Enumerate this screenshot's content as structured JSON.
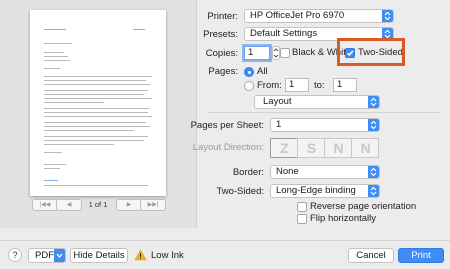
{
  "preview": {
    "pager_label": "1 of 1",
    "first_icon": "first-page-icon",
    "prev_icon": "previous-page-icon",
    "next_icon": "next-page-icon",
    "last_icon": "last-page-icon"
  },
  "printer": {
    "label": "Printer:",
    "value": "HP OfficeJet Pro 6970"
  },
  "presets": {
    "label": "Presets:",
    "value": "Default Settings"
  },
  "copies": {
    "label": "Copies:",
    "value": "1"
  },
  "black_white": {
    "label": "Black & White",
    "checked": false
  },
  "two_sided_check": {
    "label": "Two-Sided",
    "checked": true
  },
  "pages": {
    "label": "Pages:",
    "all_label": "All",
    "from_label": "From:",
    "from_value": "1",
    "to_label": "to:",
    "to_value": "1",
    "selected": "all"
  },
  "section": {
    "value": "Layout"
  },
  "pages_per_sheet": {
    "label": "Pages per Sheet:",
    "value": "1"
  },
  "layout_direction": {
    "label": "Layout Direction:",
    "glyphs": [
      "Z",
      "S",
      "N",
      "N"
    ]
  },
  "border": {
    "label": "Border:",
    "value": "None"
  },
  "two_sided": {
    "label": "Two-Sided:",
    "value": "Long-Edge binding"
  },
  "reverse_orientation": {
    "label": "Reverse page orientation",
    "checked": false
  },
  "flip_horizontally": {
    "label": "Flip horizontally",
    "checked": false
  },
  "bottom": {
    "help_label": "?",
    "pdf_label": "PDF",
    "hide_details_label": "Hide Details",
    "low_ink_label": "Low Ink",
    "cancel_label": "Cancel",
    "print_label": "Print"
  },
  "colors": {
    "accent": "#3f8cf4",
    "highlight": "#d85a24",
    "warning": "#f2b51d"
  }
}
